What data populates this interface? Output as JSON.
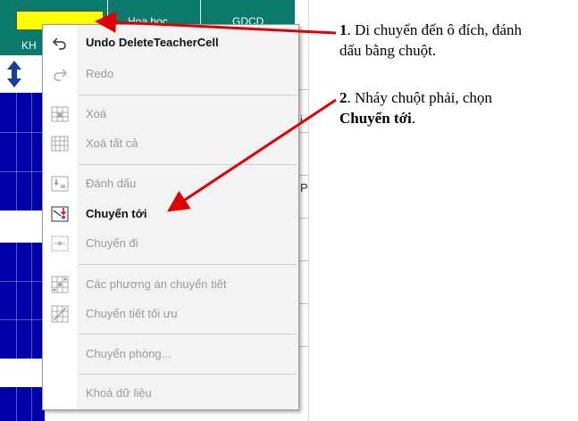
{
  "sheet": {
    "header_cells": [
      "Hoa hoc",
      "GDCD"
    ],
    "row_label": "KH",
    "edge_chars": [
      "i",
      "P"
    ]
  },
  "context_menu": {
    "items": [
      {
        "id": "undo",
        "label": "Undo DeleteTeacherCell",
        "enabled": true,
        "icon": "undo-icon"
      },
      {
        "id": "redo",
        "label": "Redo",
        "enabled": false,
        "icon": "redo-icon"
      },
      {
        "id": "xoa",
        "label": "Xoá",
        "enabled": false,
        "icon": "grid-delete-icon"
      },
      {
        "id": "xoa-tat-ca",
        "label": "Xoá tất cả",
        "enabled": false,
        "icon": "grid-delete-all-icon"
      },
      {
        "id": "danh-dau",
        "label": "Đánh dấu",
        "enabled": false,
        "icon": "mark-icon"
      },
      {
        "id": "chuyen-toi",
        "label": "Chuyển tới",
        "enabled": true,
        "icon": "move-to-icon"
      },
      {
        "id": "chuyen-di",
        "label": "Chuyển đi",
        "enabled": false,
        "icon": "move-away-icon"
      },
      {
        "id": "cac-phuong-an",
        "label": "Các phương án chuyển tiết",
        "enabled": false,
        "icon": "options-grid-icon"
      },
      {
        "id": "chuyen-tiet-toi-uu",
        "label": "Chuyển tiết tối ưu",
        "enabled": false,
        "icon": "optimize-icon"
      },
      {
        "id": "chuyen-phong",
        "label": "Chuyển phòng...",
        "enabled": false,
        "icon": ""
      },
      {
        "id": "khoa-du-lieu",
        "label": "Khoá dữ liệu",
        "enabled": false,
        "icon": ""
      }
    ]
  },
  "annotations": {
    "step1_num": "1",
    "step1_text": ". Di chuyển đến ô đích, đánh",
    "step1_text2": "dấu bằng chuột.",
    "step2_num": "2",
    "step2_text": ". Nháy chuột phải, chọn",
    "step2_bold": "Chuyển tới",
    "step2_end": "."
  },
  "colors": {
    "header_green": "#0b7a6c",
    "cell_yellow": "#ffff00",
    "grid_blue": "#0000a8",
    "arrow_red": "#e00000"
  }
}
